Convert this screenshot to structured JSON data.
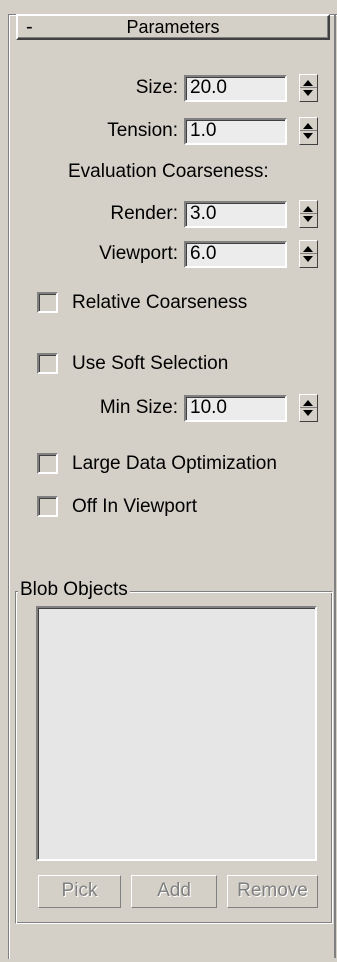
{
  "rollout": {
    "toggle": "-",
    "title": "Parameters"
  },
  "size": {
    "label": "Size:",
    "value": "20.0"
  },
  "tension": {
    "label": "Tension:",
    "value": "1.0"
  },
  "evaluation": {
    "heading": "Evaluation Coarseness:"
  },
  "render": {
    "label": "Render:",
    "value": "3.0"
  },
  "viewport": {
    "label": "Viewport:",
    "value": "6.0"
  },
  "relative_coarseness": {
    "label": "Relative Coarseness",
    "checked": false
  },
  "use_soft_selection": {
    "label": "Use Soft Selection",
    "checked": false
  },
  "min_size": {
    "label": "Min Size:",
    "value": "10.0"
  },
  "large_data": {
    "label": "Large Data Optimization",
    "checked": false
  },
  "off_in_viewport": {
    "label": "Off In Viewport",
    "checked": false
  },
  "blob_objects": {
    "title": "Blob Objects",
    "items": [],
    "buttons": {
      "pick": "Pick",
      "add": "Add",
      "remove": "Remove"
    }
  }
}
